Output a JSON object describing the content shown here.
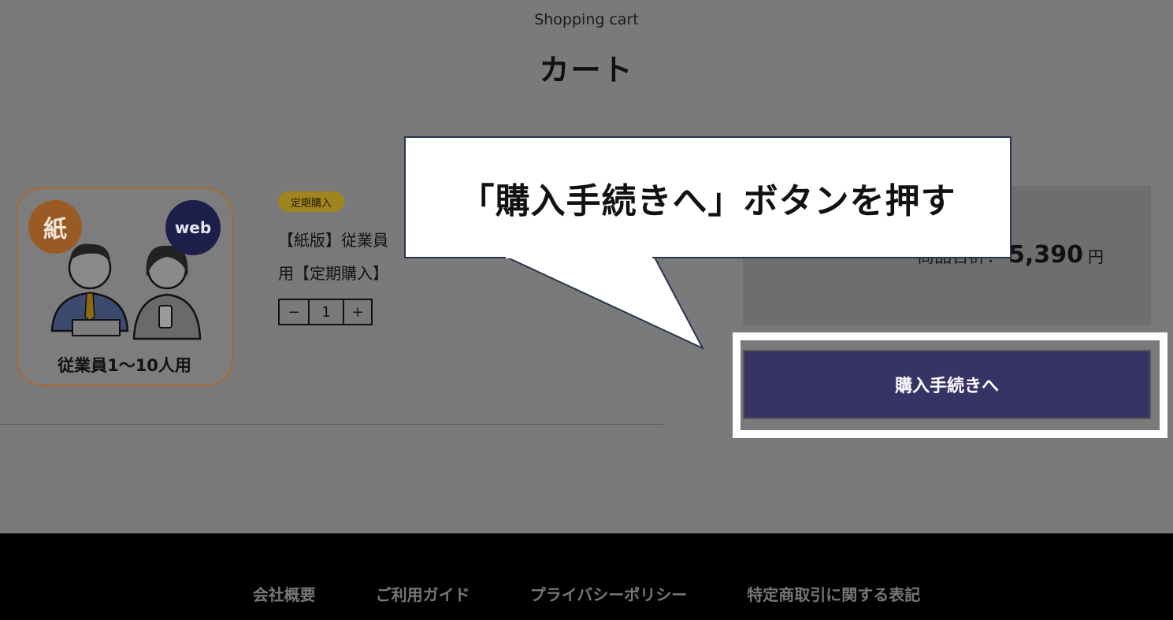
{
  "header": {
    "subtitle": "Shopping cart",
    "title": "カート"
  },
  "product": {
    "badge_paper": "紙",
    "badge_web": "web",
    "thumb_caption": "従業員1〜10人用",
    "tag": "定期購入",
    "name": "【紙版】従業員1〜10人用【定期購入】",
    "name_visible": "【紙版】従業員\n用【定期購入】",
    "quantity": "1",
    "minus_label": "−",
    "plus_label": "+"
  },
  "summary": {
    "label": "商品合計：",
    "total": "5,390",
    "unit": "円"
  },
  "checkout": {
    "button_label": "購入手続きへ"
  },
  "callout": {
    "text": "「購入手続きへ」ボタンを押す"
  },
  "footer": {
    "links": [
      "会社概要",
      "ご利用ガイド",
      "プライバシーポリシー",
      "特定商取引に関する表記"
    ]
  },
  "colors": {
    "overlay": "#7a7a7a",
    "checkout_button": "#373365",
    "tag": "#a08420",
    "highlight": "#ffffff"
  }
}
